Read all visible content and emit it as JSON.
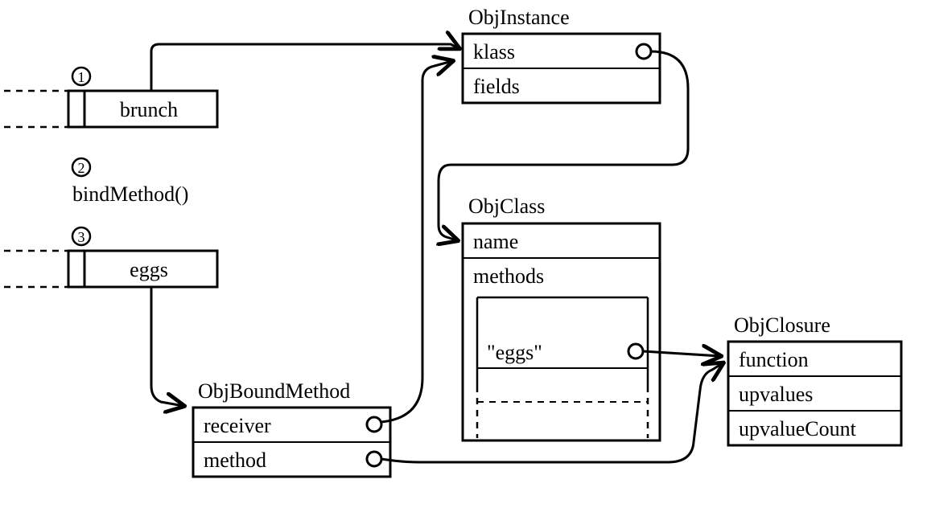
{
  "stack": {
    "step1_badge": "1",
    "step1_label": "brunch",
    "step2_badge": "2",
    "step2_label": "bindMethod()",
    "step3_badge": "3",
    "step3_label": "eggs"
  },
  "objInstance": {
    "title": "ObjInstance",
    "field1": "klass",
    "field2": "fields"
  },
  "objBoundMethod": {
    "title": "ObjBoundMethod",
    "field1": "receiver",
    "field2": "method"
  },
  "objClass": {
    "title": "ObjClass",
    "field1": "name",
    "field2": "methods",
    "entry_key": "\"eggs\""
  },
  "objClosure": {
    "title": "ObjClosure",
    "field1": "function",
    "field2": "upvalues",
    "field3": "upvalueCount"
  }
}
